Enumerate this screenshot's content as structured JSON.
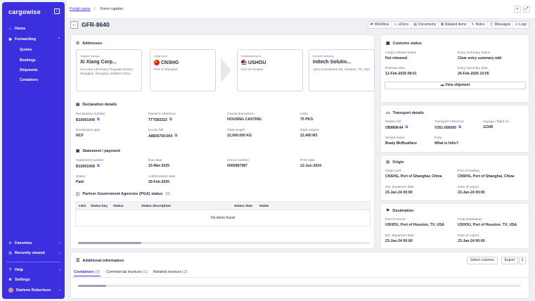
{
  "app": {
    "logo": "cargowise"
  },
  "sidebar": {
    "items": [
      {
        "label": "Home",
        "icon": "home-icon",
        "glyph": "⌂"
      },
      {
        "label": "Forwarding",
        "icon": "globe-icon",
        "glyph": "◉",
        "chev": "⌃"
      }
    ],
    "sub_items": [
      "Quotes",
      "Bookings",
      "Shipments",
      "Containers"
    ],
    "bottom": [
      {
        "label": "Favorites",
        "glyph": "☆",
        "chev": "›"
      },
      {
        "label": "Recently viewed",
        "glyph": "◷",
        "chev": "›"
      },
      {
        "label": "Help",
        "glyph": "?",
        "chev": "›"
      },
      {
        "label": "Settings",
        "glyph": "⚙",
        "chev": ""
      },
      {
        "label": "Darlene Robertson",
        "glyph": "",
        "chev": "›"
      }
    ]
  },
  "breadcrumb": {
    "portal": "Portal name",
    "sep": "/",
    "current": "Form caption"
  },
  "page": {
    "title": "GFR-8640"
  },
  "actions": [
    {
      "label": "Workflow",
      "glyph": "⇄"
    },
    {
      "label": "eDocs",
      "glyph": "▭"
    },
    {
      "label": "Documents",
      "glyph": "▤"
    },
    {
      "label": "Related items",
      "glyph": "⧉"
    },
    {
      "label": "Notes",
      "glyph": "✎"
    },
    {
      "label": "Messages",
      "glyph": "▢"
    },
    {
      "label": "Logs",
      "glyph": "≡"
    }
  ],
  "addresses": {
    "title": "Addresses",
    "pickup": {
      "label": "Supplier pickup",
      "name": "Xi Xiang Corp...",
      "sub": "Guo Hua 100 Road, Fengxian District, Shanghai, Shanghai, 826004 China"
    },
    "origin": {
      "label": "Origin port",
      "code": "CNSHG",
      "sub": "Port of Shanghai"
    },
    "destination": {
      "label": "Destination port",
      "code": "USHOU",
      "sub": "Port of Houston"
    },
    "delivery": {
      "label": "Importer delivery",
      "name": "Initech Solutio...",
      "sub": "1234 Somewhere Rd, Houston, TX, USA"
    }
  },
  "declaration": {
    "title": "Declaration details",
    "fields": [
      {
        "k": "Declaration number",
        "v": "B10001008",
        "copy": true
      },
      {
        "k": "Owner's reference",
        "v": "TTT583323",
        "copy": true
      },
      {
        "k": "Goods description",
        "v": "HOUSING CASTING",
        "copy": false
      },
      {
        "k": "Units",
        "v": "75 PKG",
        "copy": false
      },
      {
        "k": "Declaration type",
        "v": "NCF",
        "copy": false
      },
      {
        "k": "House bill",
        "v": "A8836759-004",
        "copy": true
      },
      {
        "k": "Total weight",
        "v": "12,000.000 KG",
        "copy": false
      },
      {
        "k": "Total volume",
        "v": "22.400 M3",
        "copy": false
      }
    ]
  },
  "statement": {
    "title": "Statement / payment",
    "fields": [
      {
        "k": "Statement number",
        "v": "B10001008",
        "copy": true
      },
      {
        "k": "Due date",
        "v": "15-Mar-2025",
        "copy": false
      },
      {
        "k": "Check number",
        "v": "0000987987",
        "copy": false
      },
      {
        "k": "Print date",
        "v": "12-Jun-2024",
        "copy": false
      },
      {
        "k": "Status",
        "v": "Paid",
        "copy": false
      },
      {
        "k": "Authorization date",
        "v": "25-Feb-2025",
        "copy": false
      }
    ]
  },
  "pga": {
    "title": "Partner Government Agencies (PGA) status",
    "count": "(0)",
    "columns": [
      "LNO",
      "Status key",
      "Status",
      "Status description",
      "Status date",
      "Notes"
    ],
    "empty": "No items found"
  },
  "customs": {
    "title": "Customs status",
    "fields": [
      {
        "k": "Cargo release status",
        "v": "Not released"
      },
      {
        "k": "Entry summary status",
        "v": "Clear entry summary add"
      },
      {
        "k": "Release date",
        "v": "12-Feb-2025 08:01"
      },
      {
        "k": "Entry summary date",
        "v": "26-Feb-2025 10:05"
      }
    ],
    "button": "View shipment"
  },
  "transport": {
    "title": "Transport details",
    "fields": [
      {
        "k": "Master bill",
        "v": "OBMNK44",
        "copy": true
      },
      {
        "k": "Transport reference",
        "v": "V351-006500",
        "copy": true
      },
      {
        "k": "Voyage / flight no.",
        "v": "12345",
        "copy": false
      },
      {
        "k": "Vessel name",
        "v": "Boaty McBoatface",
        "copy": false
      },
      {
        "k": "Folio",
        "v": "What is folio?",
        "copy": false
      }
    ]
  },
  "origin": {
    "title": "Origin",
    "fields": [
      {
        "k": "Origin port",
        "v": "CNSHG, Port of Shanghai, China"
      },
      {
        "k": "Port of loading",
        "v": "CNSHG, Port of Shanghai, China"
      },
      {
        "k": "Est. departure date",
        "v": "23-Jan-24 00:00"
      },
      {
        "k": "Date of export",
        "v": "23-Jan-24 00:00"
      }
    ]
  },
  "destination": {
    "title": "Destination",
    "fields": [
      {
        "k": "Port of arrival",
        "v": "USHOU, Port of Houston, TX, USA"
      },
      {
        "k": "Final destination",
        "v": "USHOU, Port of Houston, TX, USA"
      },
      {
        "k": "Est. departure date",
        "v": "23-Jan-24 00:00"
      },
      {
        "k": "Date of export",
        "v": "23-Jan-24 00:00"
      }
    ]
  },
  "additional": {
    "title": "Additional information",
    "tabs": [
      {
        "label": "Containers",
        "count": "(3)"
      },
      {
        "label": "Commercial invoices",
        "count": "(1)"
      },
      {
        "label": "Related invoices",
        "count": "(2)"
      }
    ],
    "select_columns": "Select columns",
    "export": "Export"
  },
  "colors": {
    "accent": "#3b2fe0"
  }
}
